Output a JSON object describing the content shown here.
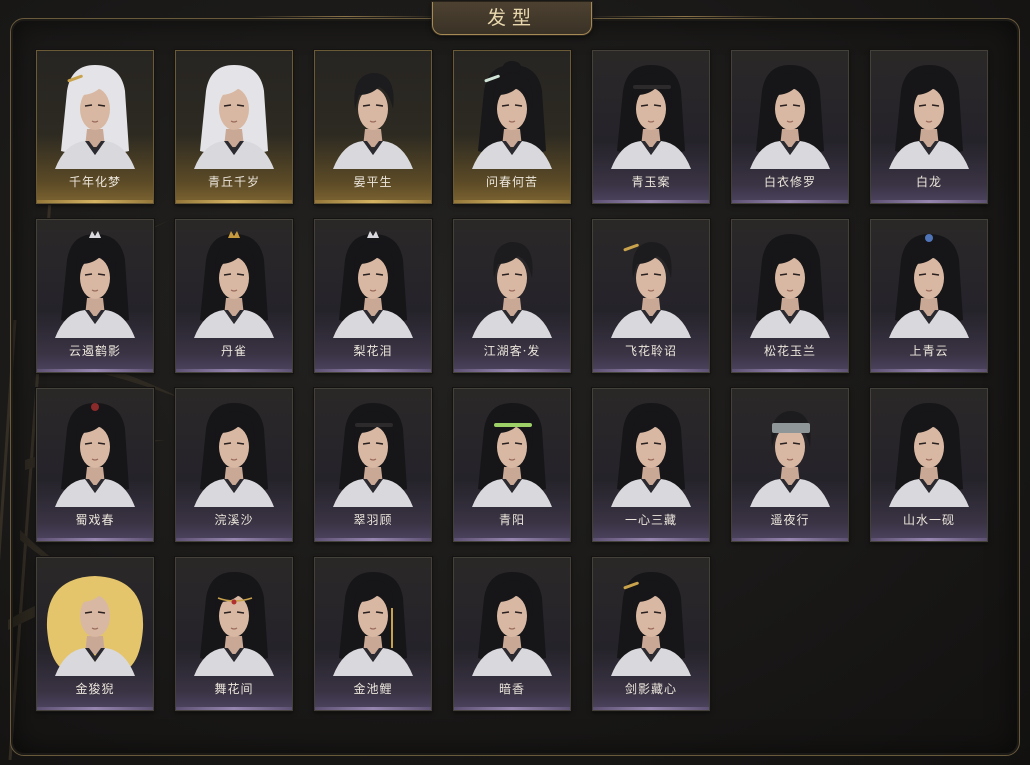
{
  "header": {
    "title": "发型"
  },
  "theme": {
    "accent": "#a68a55",
    "owned_bar": "#d8b266",
    "unowned_bar": "#b9a6d8",
    "label": "#ece6dc"
  },
  "hairstyles": [
    {
      "label": "千年化梦",
      "owned": true,
      "hair": "white",
      "accessory": "gold-pin"
    },
    {
      "label": "青丘千岁",
      "owned": true,
      "hair": "white",
      "accessory": "none"
    },
    {
      "label": "晏平生",
      "owned": true,
      "hair": "short",
      "accessory": "none"
    },
    {
      "label": "问春何苦",
      "owned": true,
      "hair": "bun",
      "accessory": "jade-pin"
    },
    {
      "label": "青玉案",
      "owned": false,
      "hair": "long",
      "accessory": "headband"
    },
    {
      "label": "白衣修罗",
      "owned": false,
      "hair": "long",
      "accessory": "none"
    },
    {
      "label": "白龙",
      "owned": false,
      "hair": "long",
      "accessory": "none"
    },
    {
      "label": "云遏鹤影",
      "owned": false,
      "hair": "long",
      "accessory": "silver-crown"
    },
    {
      "label": "丹雀",
      "owned": false,
      "hair": "long",
      "accessory": "gold-crown"
    },
    {
      "label": "梨花泪",
      "owned": false,
      "hair": "long",
      "accessory": "silver-crown"
    },
    {
      "label": "江湖客·发",
      "owned": false,
      "hair": "short",
      "accessory": "none"
    },
    {
      "label": "飞花聆诏",
      "owned": false,
      "hair": "short",
      "accessory": "gold-pin"
    },
    {
      "label": "松花玉兰",
      "owned": false,
      "hair": "long",
      "accessory": "none"
    },
    {
      "label": "上青云",
      "owned": false,
      "hair": "long",
      "accessory": "blue-tie"
    },
    {
      "label": "蜀戏春",
      "owned": false,
      "hair": "long",
      "accessory": "red-tie"
    },
    {
      "label": "浣溪沙",
      "owned": false,
      "hair": "long",
      "accessory": "none"
    },
    {
      "label": "翠羽顾",
      "owned": false,
      "hair": "long",
      "accessory": "headband"
    },
    {
      "label": "青阳",
      "owned": false,
      "hair": "long",
      "accessory": "green-band"
    },
    {
      "label": "一心三藏",
      "owned": false,
      "hair": "long",
      "accessory": "none"
    },
    {
      "label": "遥夜行",
      "owned": false,
      "hair": "short",
      "accessory": "grey-cloth"
    },
    {
      "label": "山水一砚",
      "owned": false,
      "hair": "long",
      "accessory": "none"
    },
    {
      "label": "金狻猊",
      "owned": false,
      "hair": "golden",
      "accessory": "none"
    },
    {
      "label": "舞花间",
      "owned": false,
      "hair": "long",
      "accessory": "forehead-jewel"
    },
    {
      "label": "金池鲤",
      "owned": false,
      "hair": "long",
      "accessory": "gold-tassel"
    },
    {
      "label": "暗香",
      "owned": false,
      "hair": "long",
      "accessory": "none"
    },
    {
      "label": "剑影藏心",
      "owned": false,
      "hair": "long",
      "accessory": "gold-pin"
    }
  ]
}
